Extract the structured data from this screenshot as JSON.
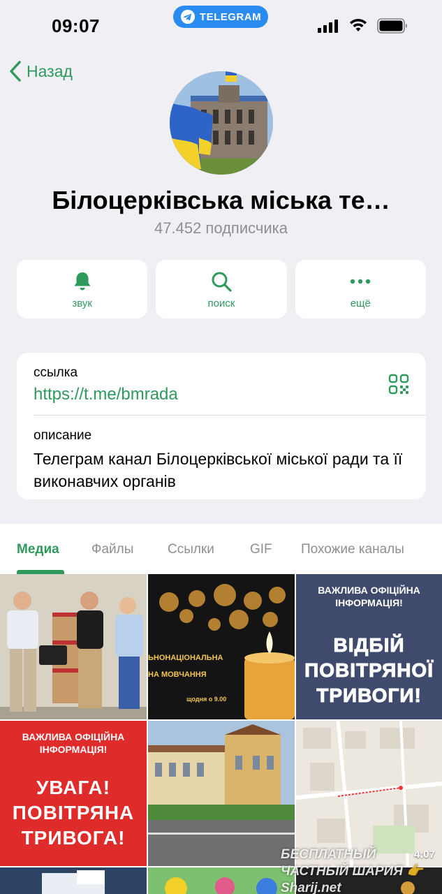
{
  "status_bar": {
    "time": "09:07",
    "app_pill": "TELEGRAM"
  },
  "nav": {
    "back_label": "Назад"
  },
  "channel": {
    "title": "Білоцерківська міська те…",
    "subscribers": "47.452 подписчика"
  },
  "actions": [
    {
      "label": "звук",
      "icon": "bell-icon"
    },
    {
      "label": "поиск",
      "icon": "search-icon"
    },
    {
      "label": "ещё",
      "icon": "more-icon"
    }
  ],
  "info": {
    "link_label": "ссылка",
    "link_value": "https://t.me/bmrada",
    "description_label": "описание",
    "description_text": "Телеграм канал Білоцерківської міської ради та її виконавчих органів"
  },
  "tabs": [
    "Медиа",
    "Файлы",
    "Ссылки",
    "GIF",
    "Похожие каналы"
  ],
  "media": {
    "candle_line1": "ЬНОНАЦІОНАЛЬНА",
    "candle_line2": "НА МОВЧАННЯ",
    "candle_line3": "щодня о 9.00",
    "poster1_small": "ВАЖЛИВА ОФІЦІЙНА ІНФОРМАЦІЯ!",
    "poster1_big": "ВІДБІЙ ПОВІТРЯНОЇ ТРИВОГИ!",
    "poster2_small": "ВАЖЛИВА ОФІЦІЙНА ІНФОРМАЦІЯ!",
    "poster2_big": "УВАГА! ПОВІТРЯНА ТРИВОГА!",
    "video_duration": "4:07"
  },
  "watermark": "БЕСПЛАТНЫЙ ЧАСТНЫЙ ШАРИЯ 👉 Sharij.net",
  "colors": {
    "accent": "#2e9a5c",
    "telegram_blue": "#2a8cf0",
    "background": "#efeff4",
    "alert_red": "#e02b2b",
    "info_navy": "#3f4a6d"
  }
}
